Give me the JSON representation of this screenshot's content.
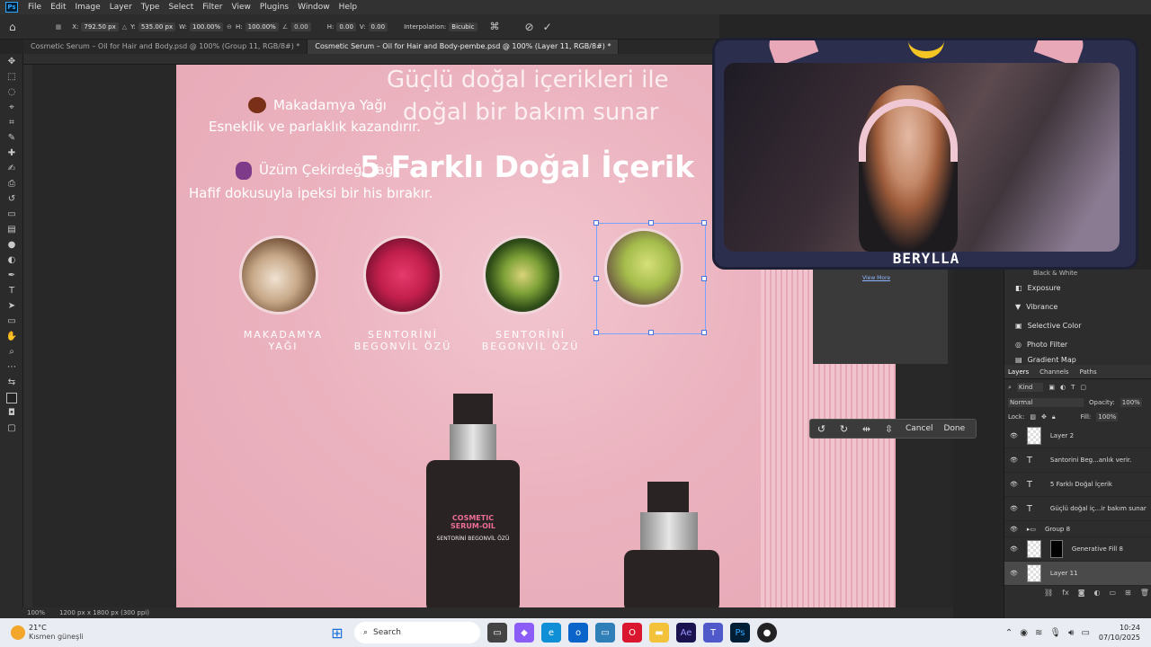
{
  "menubar": {
    "items": [
      "File",
      "Edit",
      "Image",
      "Layer",
      "Type",
      "Select",
      "Filter",
      "View",
      "Plugins",
      "Window",
      "Help"
    ]
  },
  "options": {
    "x_label": "X:",
    "x_value": "792.50 px",
    "y_label": "Y:",
    "y_value": "535.00 px",
    "w_label": "W:",
    "w_value": "100.00%",
    "h_label": "H:",
    "h_value": "100.00%",
    "angle_value": "0.00",
    "hskew_label": "H:",
    "hskew_value": "0.00",
    "vskew_label": "V:",
    "vskew_value": "0.00",
    "interp_label": "Interpolation:",
    "interp_value": "Bicubic"
  },
  "tabs": [
    {
      "label": "Cosmetic Serum – Oil for Hair and Body.psd @ 100% (Group 11, RGB/8#) *"
    },
    {
      "label": "Cosmetic Serum – Oil for Hair and Body-pembe.psd @ 100% (Layer 11, RGB/8#) *"
    }
  ],
  "canvas": {
    "line1": "Güçlü doğal içerikleri ile",
    "line2": "doğal bir bakım sunar",
    "heading": "5 Farklı Doğal İçerik",
    "item1_title": "Makadamya Yağı",
    "item1_desc": "Esneklik ve parlaklık kazandırır.",
    "item2_title": "Üzüm Çekirdeği Yağı",
    "item2_desc": "Hafif dokusuyla ipeksi bir his bırakır.",
    "circle_labels": [
      "MAKADAMYA YAĞI",
      "SENTORİNİ BEGONVİL ÖZÜ",
      "SENTORİNİ BEGONVİL ÖZÜ"
    ],
    "bottle_text1": "COSMETIC SERUM-OIL",
    "bottle_text2": "SENTORİNİ BEGONVİL ÖZÜ"
  },
  "context_bar": {
    "cancel": "Cancel",
    "done": "Done"
  },
  "webcam": {
    "name": "BERYLLA"
  },
  "adjustments": {
    "partial_top": "Black & White",
    "view_more": "View More",
    "items": [
      "Exposure",
      "Vibrance",
      "Selective Color",
      "Photo Filter",
      "Gradient Map"
    ]
  },
  "layers_panel": {
    "tabs": [
      "Layers",
      "Channels",
      "Paths"
    ],
    "kind": "Kind",
    "blend": "Normal",
    "opacity_label": "Opacity:",
    "opacity_value": "100%",
    "lock_label": "Lock:",
    "fill_label": "Fill:",
    "fill_value": "100%",
    "layers": [
      {
        "name": "Layer 2"
      },
      {
        "name": "Santorini Beg...anlık verir."
      },
      {
        "name": "5 Farklı Doğal İçerik"
      },
      {
        "name": "Güçlü doğal iç...ir bakım sunar"
      },
      {
        "name": "Group 8"
      },
      {
        "name": "Generative Fill 8"
      },
      {
        "name": "Layer 11"
      }
    ]
  },
  "status": {
    "zoom": "100%",
    "doc": "1200 px x 1800 px (300 ppi)"
  },
  "taskbar": {
    "weather_temp": "21°C",
    "weather_desc": "Kısmen güneşli",
    "search_placeholder": "Search",
    "time": "10:24",
    "date": "07/10/2025"
  },
  "colors": {
    "accent": "#31a8ff",
    "pink": "#ebb3bf",
    "selection": "#4a76e0"
  }
}
